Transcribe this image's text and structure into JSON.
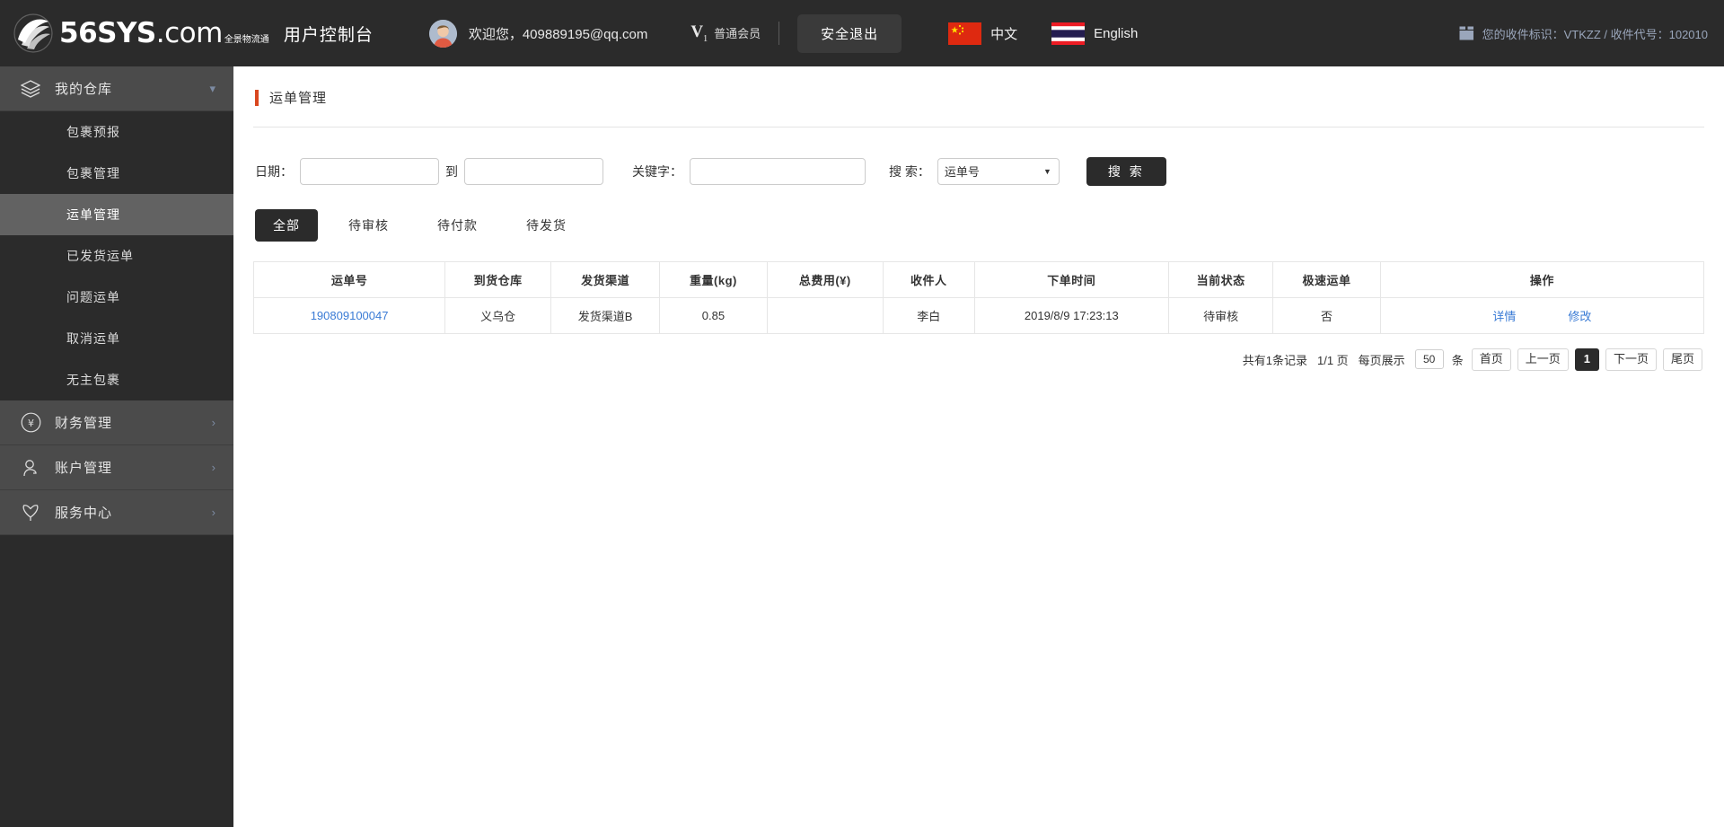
{
  "header": {
    "logo_main": "56SYS",
    "logo_dotcom": ".com",
    "logo_sub_line1": "全景物流通",
    "console_title": "用户控制台",
    "welcome": "欢迎您，409889195@qq.com",
    "vip_glyph": "V",
    "vip_sub": "1",
    "vip_label": "普通会员",
    "logout_label": "安全退出",
    "languages": [
      {
        "label": "中文",
        "flag": "cn-flag-icon"
      },
      {
        "label": "English",
        "flag": "th-flag-icon"
      }
    ],
    "receiver_id_text": "您的收件标识：VTKZZ / 收件代号：102010",
    "receiver_icon": "package-box-icon",
    "avatar_icon": "avatar",
    "bg_color": "#2b2b2b"
  },
  "sidebar": {
    "groups": [
      {
        "label": "我的仓库",
        "icon": "layers-icon",
        "caret": "chevron-down-icon",
        "expanded": true,
        "items": [
          {
            "label": "包裹预报",
            "active": false
          },
          {
            "label": "包裹管理",
            "active": false
          },
          {
            "label": "运单管理",
            "active": true
          },
          {
            "label": "已发货运单",
            "active": false
          },
          {
            "label": "问题运单",
            "active": false
          },
          {
            "label": "取消运单",
            "active": false
          },
          {
            "label": "无主包裹",
            "active": false
          }
        ]
      },
      {
        "label": "财务管理",
        "icon": "yen-circle-icon",
        "caret": "chevron-right-icon",
        "expanded": false,
        "items": []
      },
      {
        "label": "账户管理",
        "icon": "user-icon",
        "caret": "chevron-right-icon",
        "expanded": false,
        "items": []
      },
      {
        "label": "服务中心",
        "icon": "shield-icon",
        "caret": "chevron-right-icon",
        "expanded": false,
        "items": []
      }
    ],
    "bg_color": "#2b2b2b",
    "active_color": "#626262"
  },
  "main": {
    "page_title": "运单管理",
    "accent_color": "#d9471f",
    "filters": {
      "date_label": "日期：",
      "date_from_value": "",
      "date_from_placeholder": "",
      "between_label": "到",
      "date_to_value": "",
      "date_to_placeholder": "",
      "keyword_label": "关键字：",
      "keyword_value": "",
      "keyword_placeholder": "",
      "search_field_label": "搜 索：",
      "search_field_selected": "运单号",
      "search_field_options": [
        "运单号"
      ],
      "search_button": "搜 索"
    },
    "tabs": [
      {
        "label": "全部",
        "active": true
      },
      {
        "label": "待审核",
        "active": false
      },
      {
        "label": "待付款",
        "active": false
      },
      {
        "label": "待发货",
        "active": false
      }
    ],
    "table": {
      "columns": [
        "运单号",
        "到货仓库",
        "发货渠道",
        "重量(kg)",
        "总费用(¥)",
        "收件人",
        "下单时间",
        "当前状态",
        "极速运单",
        "操作"
      ],
      "rows": [
        {
          "waybill_no": "190809100047",
          "warehouse": "义乌仓",
          "channel": "发货渠道B",
          "weight": "0.85",
          "total_fee": "",
          "receiver": "李白",
          "order_time": "2019/8/9 17:23:13",
          "status": "待审核",
          "express": "否",
          "ops": [
            "详情",
            "修改"
          ]
        }
      ]
    },
    "pagination": {
      "total_text": "共有1条记录",
      "page_text": "1/1 页",
      "per_page_label": "每页展示",
      "per_page_value": "50",
      "per_page_unit": "条",
      "first": "首页",
      "prev": "上一页",
      "current": "1",
      "next": "下一页",
      "last": "尾页"
    }
  }
}
